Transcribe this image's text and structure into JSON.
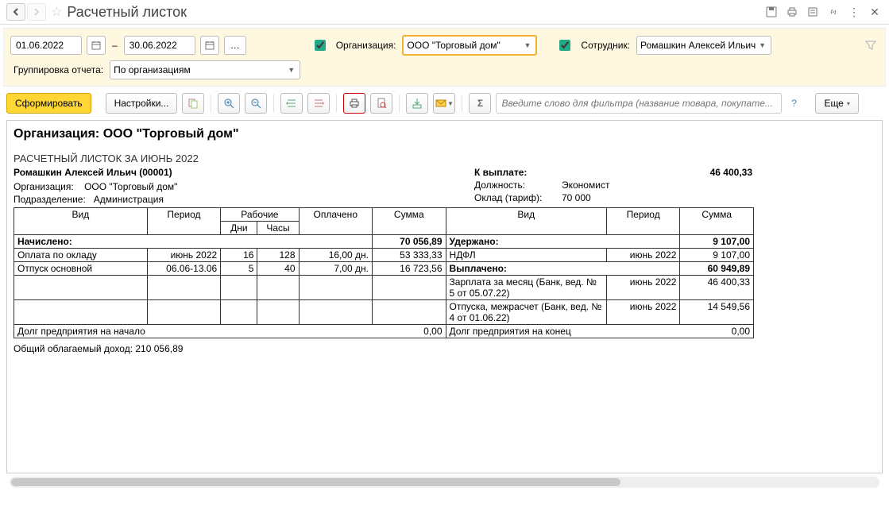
{
  "title": "Расчетный листок",
  "filters": {
    "date_from": "01.06.2022",
    "date_to": "30.06.2022",
    "org_label": "Организация:",
    "org_value": "ООО \"Торговый дом\"",
    "emp_label": "Сотрудник:",
    "emp_value": "Ромашкин Алексей Ильич",
    "group_label": "Группировка отчета:",
    "group_value": "По организациям"
  },
  "toolbar": {
    "generate": "Сформировать",
    "settings": "Настройки...",
    "more": "Еще",
    "search_placeholder": "Введите слово для фильтра (название товара, покупате..."
  },
  "report": {
    "org_header": "Организация: ООО \"Торговый дом\"",
    "slip_period": "РАСЧЕТНЫЙ ЛИСТОК ЗА ИЮНЬ 2022",
    "employee": "Ромашкин Алексей Ильич (00001)",
    "meta_left": {
      "org_label": "Организация:",
      "org_value": "ООО \"Торговый дом\"",
      "dep_label": "Подразделение:",
      "dep_value": "Администрация"
    },
    "meta_right": {
      "topay_label": "К выплате:",
      "topay_value": "46 400,33",
      "pos_label": "Должность:",
      "pos_value": "Экономист",
      "salary_label": "Оклад (тариф):",
      "salary_value": "70 000"
    },
    "headers": {
      "vid": "Вид",
      "period": "Период",
      "workdays_group": "Рабочие",
      "days": "Дни",
      "hours": "Часы",
      "paid": "Оплачено",
      "sum": "Сумма"
    },
    "accrued_label": "Начислено:",
    "accrued_total": "70 056,89",
    "accrued_rows": [
      {
        "name": "Оплата по окладу",
        "period": "июнь 2022",
        "days": "16",
        "hours": "128",
        "paid": "16,00 дн.",
        "sum": "53 333,33"
      },
      {
        "name": "Отпуск основной",
        "period": "06.06-13.06",
        "days": "5",
        "hours": "40",
        "paid": "7,00 дн.",
        "sum": "16 723,56"
      }
    ],
    "withheld_label": "Удержано:",
    "withheld_total": "9 107,00",
    "withheld_rows": [
      {
        "name": "НДФЛ",
        "period": "июнь 2022",
        "sum": "9 107,00"
      }
    ],
    "paid_label": "Выплачено:",
    "paid_total": "60 949,89",
    "paid_rows": [
      {
        "name": "Зарплата за месяц (Банк, вед. № 5 от 05.07.22)",
        "period": "июнь 2022",
        "sum": "46 400,33"
      },
      {
        "name": "Отпуска, межрасчет (Банк, вед. № 4 от 01.06.22)",
        "period": "июнь 2022",
        "sum": "14 549,56"
      }
    ],
    "debt_start_label": "Долг предприятия на начало",
    "debt_start_value": "0,00",
    "debt_end_label": "Долг предприятия на конец",
    "debt_end_value": "0,00",
    "taxable_income": "Общий облагаемый доход: 210 056,89"
  }
}
